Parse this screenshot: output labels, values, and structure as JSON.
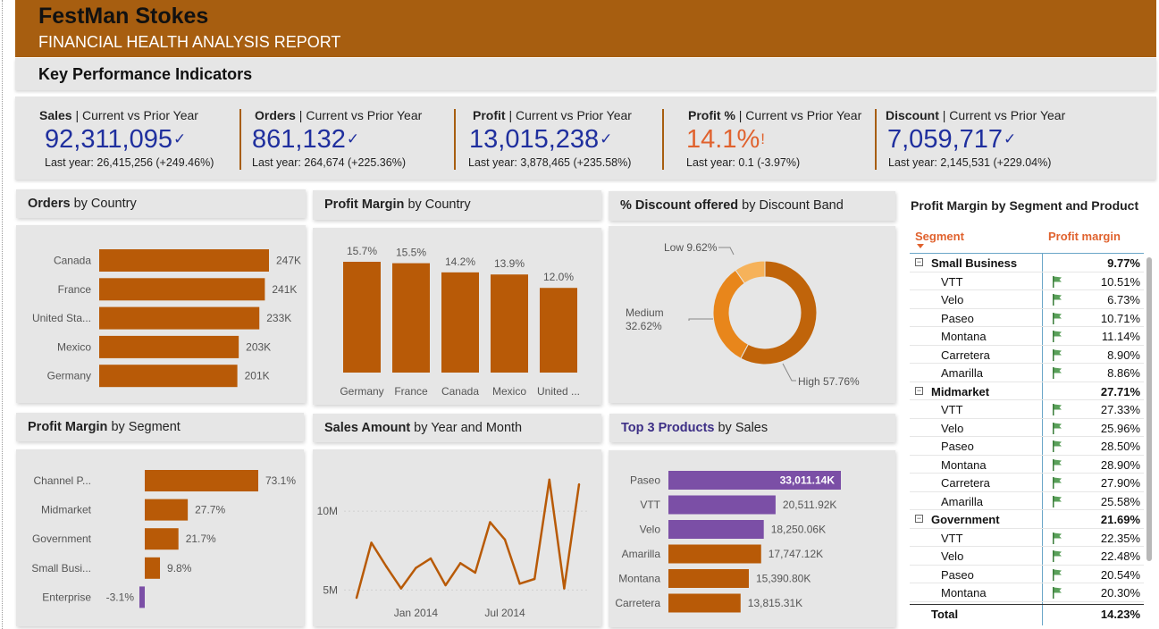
{
  "header": {
    "company": "FestMan Stokes",
    "subtitle": "FINANCIAL HEALTH ANALYSIS REPORT"
  },
  "kpi_section": {
    "label": "Key Performance Indicators"
  },
  "kpis": [
    {
      "name": "Sales",
      "suffix": " | Current vs Prior Year",
      "value": "92,311,095",
      "indicator": "✓",
      "last_year": "Last year: 26,415,256 (+249.46%)",
      "color": "#1f2f9e"
    },
    {
      "name": "Orders",
      "suffix": " | Current vs Prior Year",
      "value": "861,132",
      "indicator": "✓",
      "last_year": "Last year: 264,674 (+225.36%)",
      "color": "#1f2f9e"
    },
    {
      "name": "Profit",
      "suffix": " | Current vs Prior Year",
      "value": "13,015,238",
      "indicator": "✓",
      "last_year": "Last year: 3,878,465 (+235.58%)",
      "color": "#1f2f9e"
    },
    {
      "name": "Profit %",
      "suffix": " | Current vs Prior Year",
      "value": "14.1%",
      "indicator": "!",
      "last_year": "Last year: 0.1 (-3.97%)",
      "color": "#e0622e"
    },
    {
      "name": "Discount",
      "suffix": " | Current vs Prior Year",
      "value": "7,059,717",
      "indicator": "✓",
      "last_year": "Last year: 2,145,531 (+229.04%)",
      "color": "#1f2f9e"
    }
  ],
  "panels": {
    "orders_country": {
      "bold": "Orders",
      "rest": " by Country"
    },
    "profit_margin_country": {
      "bold": "Profit Margin",
      "rest": " by Country"
    },
    "discount_band": {
      "bold": "% Discount offered",
      "rest": " by Discount Band"
    },
    "profit_margin_segment": {
      "bold": "Profit Margin",
      "rest": " by Segment"
    },
    "sales_year_month": {
      "bold": "Sales Amount",
      "rest": " by Year and Month"
    },
    "top3_products": {
      "bold": "Top 3 Products",
      "rest": " by Sales"
    }
  },
  "colors": {
    "primary": "#b85a07",
    "highlight": "#7b4fa6",
    "header": "#a75e10",
    "kpi_blue": "#1f2f9e",
    "warn": "#e0622e"
  },
  "chart_data": [
    {
      "id": "orders_by_country",
      "type": "bar",
      "orientation": "horizontal",
      "categories": [
        "Canada",
        "France",
        "United Sta...",
        "Mexico",
        "Germany"
      ],
      "values": [
        247,
        241,
        233,
        203,
        201
      ],
      "labels": [
        "247K",
        "241K",
        "233K",
        "203K",
        "201K"
      ],
      "unit": "K",
      "xlim": [
        0,
        247
      ]
    },
    {
      "id": "profit_margin_by_country",
      "type": "bar",
      "orientation": "vertical",
      "categories": [
        "Germany",
        "France",
        "Canada",
        "Mexico",
        "United ..."
      ],
      "values": [
        15.7,
        15.5,
        14.2,
        13.9,
        12.0
      ],
      "labels": [
        "15.7%",
        "15.5%",
        "14.2%",
        "13.9%",
        "12.0%"
      ],
      "ylim": [
        0,
        15.7
      ]
    },
    {
      "id": "discount_by_band",
      "type": "pie",
      "donut": true,
      "categories": [
        "High",
        "Medium",
        "Low"
      ],
      "values": [
        57.76,
        32.62,
        9.62
      ],
      "labels": [
        "High 57.76%",
        "Medium 32.62%",
        "Low 9.62%"
      ],
      "colors": [
        "#c0640a",
        "#e8861b",
        "#f6b25a"
      ]
    },
    {
      "id": "profit_margin_by_segment",
      "type": "bar",
      "orientation": "horizontal",
      "categories": [
        "Channel P...",
        "Midmarket",
        "Government",
        "Small Busi...",
        "Enterprise"
      ],
      "values": [
        73.1,
        27.7,
        21.7,
        9.8,
        -3.1
      ],
      "labels": [
        "73.1%",
        "27.7%",
        "21.7%",
        "9.8%",
        "-3.1%"
      ],
      "xlim": [
        -3.1,
        73.1
      ]
    },
    {
      "id": "sales_by_year_month",
      "type": "line",
      "x": [
        "2013-09",
        "2013-10",
        "2013-11",
        "2013-12",
        "2014-01",
        "2014-02",
        "2014-03",
        "2014-04",
        "2014-05",
        "2014-06",
        "2014-07",
        "2014-08",
        "2014-09",
        "2014-10",
        "2014-11",
        "2014-12"
      ],
      "values": [
        4.5,
        8.0,
        6.5,
        5.1,
        6.4,
        7.0,
        5.3,
        6.7,
        6.1,
        9.3,
        8.2,
        5.4,
        5.7,
        12.0,
        5.1,
        11.7
      ],
      "yticks": [
        {
          "value": 5,
          "label": "5M"
        },
        {
          "value": 10,
          "label": "10M"
        }
      ],
      "xticks": [
        {
          "index": 4,
          "label": "Jan 2014"
        },
        {
          "index": 10,
          "label": "Jul 2014"
        }
      ],
      "ylim": [
        4,
        12.5
      ]
    },
    {
      "id": "top3_products_by_sales",
      "type": "bar",
      "orientation": "horizontal",
      "categories": [
        "Paseo",
        "VTT",
        "Velo",
        "Amarilla",
        "Montana",
        "Carretera"
      ],
      "values": [
        33011.14,
        20511.92,
        18250.06,
        17747.12,
        15390.8,
        13815.31
      ],
      "labels": [
        "33,011.14K",
        "20,511.92K",
        "18,250.06K",
        "17,747.12K",
        "15,390.80K",
        "13,815.31K"
      ],
      "highlight": [
        true,
        true,
        true,
        false,
        false,
        false
      ],
      "xlim": [
        0,
        33011.14
      ]
    }
  ],
  "matrix": {
    "title": "Profit Margin by Segment and Product",
    "col_segment": "Segment",
    "col_margin": "Profit margin",
    "rows": [
      {
        "level": 0,
        "name": "Small Business",
        "value": "9.77%"
      },
      {
        "level": 1,
        "name": "VTT",
        "value": "10.51%"
      },
      {
        "level": 1,
        "name": "Velo",
        "value": "6.73%"
      },
      {
        "level": 1,
        "name": "Paseo",
        "value": "10.71%"
      },
      {
        "level": 1,
        "name": "Montana",
        "value": "11.14%"
      },
      {
        "level": 1,
        "name": "Carretera",
        "value": "8.90%"
      },
      {
        "level": 1,
        "name": "Amarilla",
        "value": "8.86%"
      },
      {
        "level": 0,
        "name": "Midmarket",
        "value": "27.71%"
      },
      {
        "level": 1,
        "name": "VTT",
        "value": "27.33%"
      },
      {
        "level": 1,
        "name": "Velo",
        "value": "25.96%"
      },
      {
        "level": 1,
        "name": "Paseo",
        "value": "28.50%"
      },
      {
        "level": 1,
        "name": "Montana",
        "value": "28.90%"
      },
      {
        "level": 1,
        "name": "Carretera",
        "value": "27.90%"
      },
      {
        "level": 1,
        "name": "Amarilla",
        "value": "25.58%"
      },
      {
        "level": 0,
        "name": "Government",
        "value": "21.69%"
      },
      {
        "level": 1,
        "name": "VTT",
        "value": "22.35%"
      },
      {
        "level": 1,
        "name": "Velo",
        "value": "22.48%"
      },
      {
        "level": 1,
        "name": "Paseo",
        "value": "20.54%"
      },
      {
        "level": 1,
        "name": "Montana",
        "value": "20.30%"
      }
    ],
    "total": {
      "name": "Total",
      "value": "14.23%"
    }
  }
}
